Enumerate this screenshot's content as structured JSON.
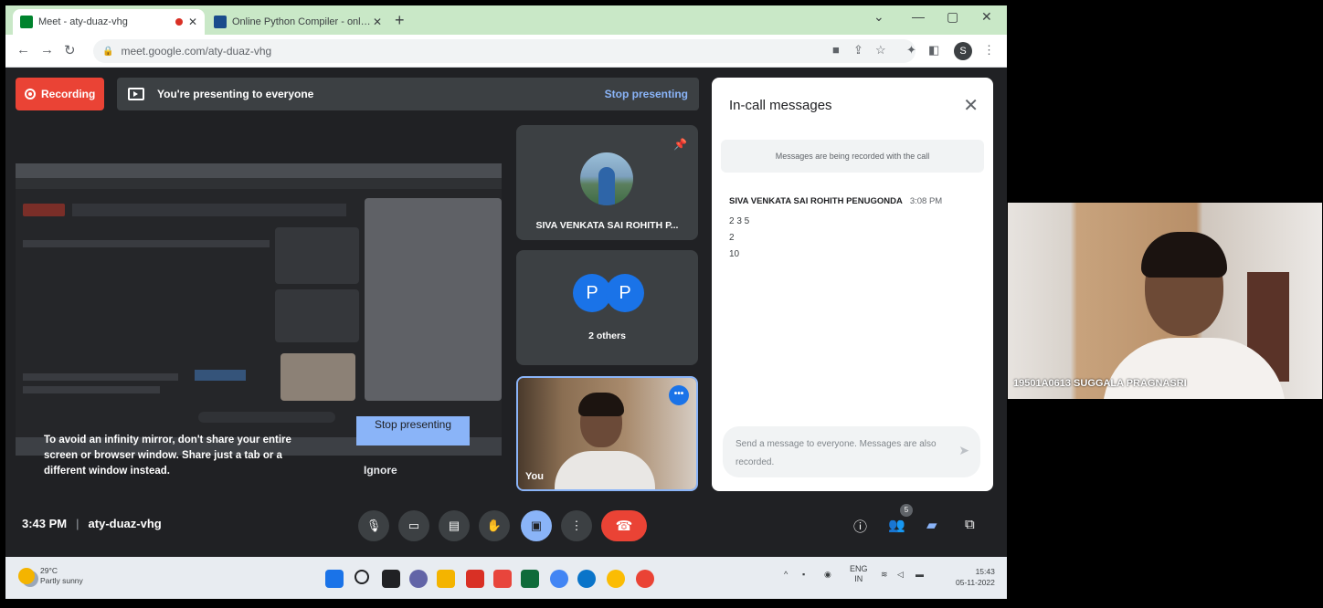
{
  "browser": {
    "tabs": [
      {
        "title": "Meet - aty-duaz-vhg",
        "favicon_color": "#00832d",
        "recording": true
      },
      {
        "title": "Online Python Compiler - online",
        "favicon_color": "#1a4b8c"
      }
    ],
    "new_tab_label": "+",
    "url": "meet.google.com/aty-duaz-vhg",
    "profile_initial": "S"
  },
  "meet": {
    "recording_label": "Recording",
    "presenting_message": "You're presenting to everyone",
    "stop_presenting_link": "Stop presenting",
    "mirror_warning": "To avoid an infinity mirror, don't share your entire screen or browser window. Share just a tab or a different window instead.",
    "stop_presenting_button": "Stop presenting",
    "ignore_button": "Ignore",
    "time": "3:43 PM",
    "separator": "|",
    "meeting_code": "aty-duaz-vhg",
    "people_count": "5"
  },
  "participants": [
    {
      "name": "SIVA VENKATA SAI ROHITH P..."
    },
    {
      "name": "2 others",
      "initials": [
        "P",
        "P"
      ]
    },
    {
      "name": "You"
    }
  ],
  "chat": {
    "title": "In-call messages",
    "notice": "Messages are being recorded with the call",
    "messages": [
      {
        "sender": "SIVA VENKATA SAI ROHITH PENUGONDA",
        "time": "3:08 PM",
        "lines": [
          "2 3 5",
          "2",
          "10"
        ]
      }
    ],
    "input_placeholder": "Send a message to everyone. Messages are also recorded."
  },
  "taskbar": {
    "temperature": "29°C",
    "weather": "Partly sunny",
    "language_line1": "ENG",
    "language_line2": "IN",
    "clock_time": "15:43",
    "clock_date": "05-11-2022"
  },
  "remote_video": {
    "name": "19501A0613 SUGGALA PRAGNASRI"
  },
  "colors": {
    "recording": "#ea4335",
    "accent": "#8ab4f8",
    "meet_bg": "#202124",
    "tab_strip": "#c9e8c7"
  }
}
